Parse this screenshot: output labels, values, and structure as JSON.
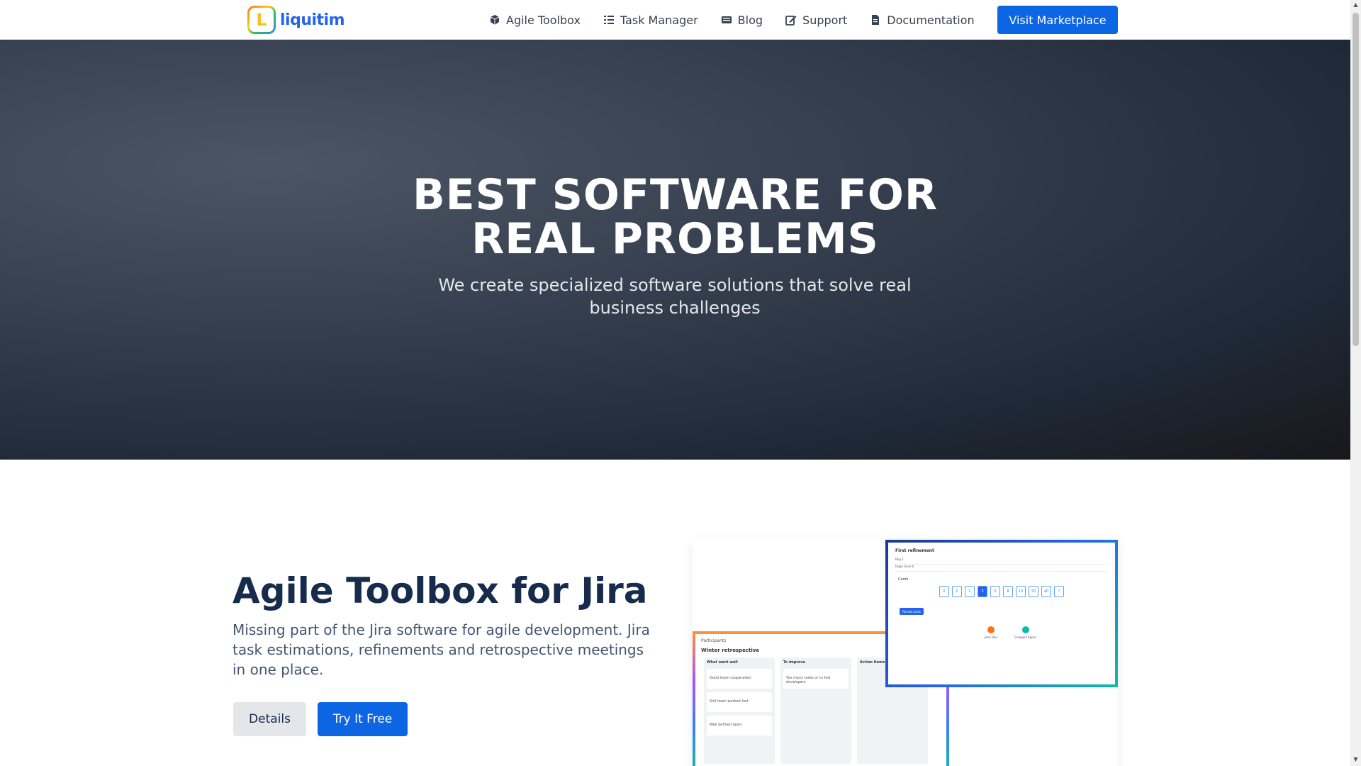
{
  "brand": {
    "logo_letter": "L",
    "name": "liquitim"
  },
  "nav": {
    "items": [
      {
        "label": "Agile Toolbox",
        "icon": "cube-icon"
      },
      {
        "label": "Task Manager",
        "icon": "list-icon"
      },
      {
        "label": "Blog",
        "icon": "newspaper-icon"
      },
      {
        "label": "Support",
        "icon": "edit-icon"
      },
      {
        "label": "Documentation",
        "icon": "document-icon"
      }
    ],
    "cta_label": "Visit Marketplace"
  },
  "hero": {
    "title_line1": "BEST SOFTWARE FOR",
    "title_line2": "REAL PROBLEMS",
    "subtitle": "We create specialized software solutions that solve real business challenges"
  },
  "product": {
    "title": "Agile Toolbox for Jira",
    "description": "Missing part of the Jira software for agile development. Jira task estimations, refinements and retrospective meetings in one place.",
    "details_label": "Details",
    "try_label": "Try It Free"
  },
  "retro_shot": {
    "participants": "Participants",
    "title": "Winter retrospective",
    "columns": [
      {
        "header": "What went well",
        "cards": [
          "Good team cooperation",
          "Still team worked fast",
          "Well defined tasks"
        ]
      },
      {
        "header": "To improve",
        "cards": [
          "Too many tasks or to few developers"
        ]
      },
      {
        "header": "Action items",
        "cards": []
      }
    ]
  },
  "refine_shot": {
    "title": "First refinement",
    "rows": [
      "Bug 1",
      "Huge issue 8"
    ],
    "cards_label": "Cards",
    "cards": [
      "0",
      "1",
      "2",
      "3",
      "5",
      "8",
      "13",
      "20",
      "40",
      "?"
    ],
    "selected_card": "3",
    "reveal_label": "Reveal cards",
    "voters": [
      {
        "name": "John Doe",
        "color": "#f97316"
      },
      {
        "name": "Grzegorz Kopec",
        "color": "#14b8a6"
      }
    ]
  }
}
